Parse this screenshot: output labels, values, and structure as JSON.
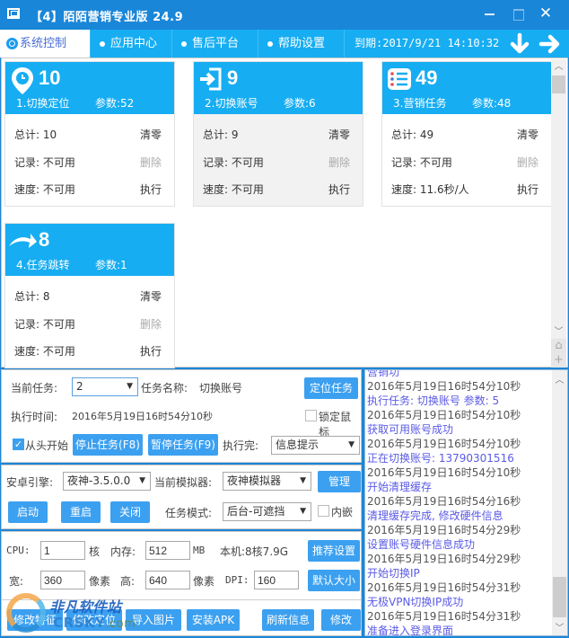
{
  "window": {
    "title": "【4】陌陌营销专业版 24.9",
    "controls": {
      "minimize": "—",
      "maximize": "□",
      "close": "✕"
    }
  },
  "tabs": [
    {
      "label": "系统控制",
      "active": true
    },
    {
      "label": "应用中心",
      "active": false
    },
    {
      "label": "售后平台",
      "active": false
    },
    {
      "label": "帮助设置",
      "active": false
    }
  ],
  "expiry": "到期:2017/9/21 14:10:32",
  "cards": [
    {
      "icon": "location-pin-clock-icon",
      "count": "10",
      "name": "1.切换定位",
      "param": "参数:52",
      "total_label": "总计:",
      "total": "10",
      "record_label": "记录:",
      "record": "不可用",
      "speed_label": "速度:",
      "speed": "不可用",
      "clear": "清零",
      "delete": "删除",
      "run": "执行",
      "grey": false
    },
    {
      "icon": "sign-in-icon",
      "count": "9",
      "name": "2.切换账号",
      "param": "参数:6",
      "total_label": "总计:",
      "total": "9",
      "record_label": "记录:",
      "record": "不可用",
      "speed_label": "速度:",
      "speed": "不可用",
      "clear": "清零",
      "delete": "删除",
      "run": "执行",
      "grey": true
    },
    {
      "icon": "task-list-icon",
      "count": "49",
      "name": "3.营销任务",
      "param": "参数:48",
      "total_label": "总计:",
      "total": "49",
      "record_label": "记录:",
      "record": "不可用",
      "speed_label": "速度:",
      "speed": "11.6秒/人",
      "clear": "清零",
      "delete": "删除",
      "run": "执行",
      "grey": false
    },
    {
      "icon": "jump-arrow-icon",
      "count": "8",
      "name": "4.任务跳转",
      "param": "参数:1",
      "total_label": "总计:",
      "total": "8",
      "record_label": "记录:",
      "record": "不可用",
      "speed_label": "速度:",
      "speed": "不可用",
      "clear": "清零",
      "delete": "删除",
      "run": "执行",
      "grey": false
    }
  ],
  "task_panel": {
    "current_task_label": "当前任务:",
    "current_task_value": "2",
    "task_name_label": "任务名称:",
    "task_name_value": "切换账号",
    "locate_button": "定位任务",
    "exec_time_label": "执行时间:",
    "exec_time_value": "2016年5月19日16时54分10秒",
    "lock_mouse_label": "锁定鼠标",
    "lock_mouse_checked": false,
    "from_start_label": "从头开始",
    "from_start_checked": true,
    "stop_button": "停止任务(F8)",
    "pause_button": "暂停任务(F9)",
    "after_exec_label": "执行完:",
    "after_exec_value": "信息提示"
  },
  "engine_panel": {
    "engine_label": "安卓引擎:",
    "engine_value": "夜神-3.5.0.0",
    "emulator_label": "当前模拟器:",
    "emulator_value": "夜神模拟器",
    "manage_button": "管理",
    "start_button": "启动",
    "restart_button": "重启",
    "close_button": "关闭",
    "mode_label": "任务模式:",
    "mode_value": "后台-可遮挡",
    "embed_label": "内嵌",
    "embed_checked": false
  },
  "device_panel": {
    "cpu_label": "CPU:",
    "cpu_value": "1",
    "cpu_unit": "核",
    "mem_label": "内存:",
    "mem_value": "512",
    "mem_unit": "MB",
    "host_info": "本机:8核7.9G",
    "recommend_button": "推荐设置",
    "width_label": "宽:",
    "width_value": "360",
    "width_unit": "像素",
    "height_label": "高:",
    "height_value": "640",
    "height_unit": "像素",
    "dpi_label": "DPI:",
    "dpi_value": "160",
    "default_size_button": "默认大小",
    "modify_feature_button": "修改特征",
    "modify_location_button": "修改定位",
    "import_image_button": "导入图片",
    "install_apk_button": "安装APK",
    "refresh_button": "刷新信息",
    "modify_button": "修改"
  },
  "log": [
    {
      "type": "msg",
      "text": "营销功"
    },
    {
      "type": "time",
      "text": "2016年5月19日16时54分10秒"
    },
    {
      "type": "msg",
      "text": "执行任务: 切换账号 参数: 5"
    },
    {
      "type": "time",
      "text": "2016年5月19日16时54分10秒"
    },
    {
      "type": "msg",
      "text": "获取可用账号成功"
    },
    {
      "type": "time",
      "text": "2016年5月19日16时54分10秒"
    },
    {
      "type": "msg",
      "text": "正在切换账号: 13790301516"
    },
    {
      "type": "time",
      "text": "2016年5月19日16时54分10秒"
    },
    {
      "type": "msg",
      "text": "开始清理缓存"
    },
    {
      "type": "time",
      "text": "2016年5月19日16时54分16秒"
    },
    {
      "type": "msg",
      "text": "清理缓存完成, 修改硬件信息"
    },
    {
      "type": "time",
      "text": "2016年5月19日16时54分29秒"
    },
    {
      "type": "msg",
      "text": "设置账号硬件信息成功"
    },
    {
      "type": "time",
      "text": "2016年5月19日16时54分29秒"
    },
    {
      "type": "msg",
      "text": "开始切换IP"
    },
    {
      "type": "time",
      "text": "2016年5月19日16时54分31秒"
    },
    {
      "type": "msg",
      "text": "无极VPN切换IP成功"
    },
    {
      "type": "time",
      "text": "2016年5月19日16时54分31秒"
    },
    {
      "type": "msg",
      "text": "准备进入登录界面"
    }
  ],
  "watermark": {
    "title": "非凡软件站",
    "sub": "CRSKY",
    "sub_domain": ".com"
  },
  "colors": {
    "titlebar": "#1a86d8",
    "tabbar": "#17adf2",
    "card_header": "#17adf2",
    "button": "#3ca0f0",
    "log_message": "#5a5ae6"
  }
}
